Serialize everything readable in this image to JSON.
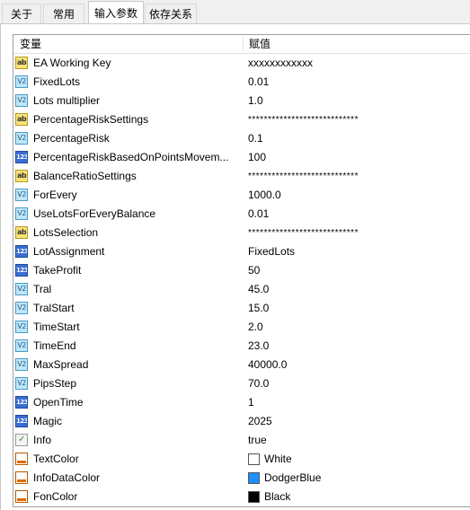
{
  "tabs": [
    {
      "label": "关于",
      "active": false
    },
    {
      "label": "常用",
      "active": false
    },
    {
      "label": "输入参数",
      "active": true
    },
    {
      "label": "依存关系",
      "active": false
    }
  ],
  "grid": {
    "headers": {
      "variable": "变量",
      "value": "赋值"
    },
    "rows": [
      {
        "icon": "string-icon",
        "glyph": "ab",
        "name": "EA Working Key",
        "value": "xxxxxxxxxxxx"
      },
      {
        "icon": "double-icon",
        "glyph": "V2",
        "name": "FixedLots",
        "value": "0.01"
      },
      {
        "icon": "double-icon",
        "glyph": "V2",
        "name": "Lots multiplier",
        "value": "1.0"
      },
      {
        "icon": "string-icon",
        "glyph": "ab",
        "name": "PercentageRiskSettings",
        "value": "****************************"
      },
      {
        "icon": "double-icon",
        "glyph": "V2",
        "name": "PercentageRisk",
        "value": "0.1"
      },
      {
        "icon": "integer-icon",
        "glyph": "123",
        "name": "PercentageRiskBasedOnPointsMovem...",
        "value": "100"
      },
      {
        "icon": "string-icon",
        "glyph": "ab",
        "name": "BalanceRatioSettings",
        "value": "****************************"
      },
      {
        "icon": "double-icon",
        "glyph": "V2",
        "name": "ForEvery",
        "value": "1000.0"
      },
      {
        "icon": "double-icon",
        "glyph": "V2",
        "name": "UseLotsForEveryBalance",
        "value": "0.01"
      },
      {
        "icon": "string-icon",
        "glyph": "ab",
        "name": "LotsSelection",
        "value": "****************************"
      },
      {
        "icon": "integer-icon",
        "glyph": "123",
        "name": "LotAssignment",
        "value": "FixedLots"
      },
      {
        "icon": "integer-icon",
        "glyph": "123",
        "name": "TakeProfit",
        "value": "50"
      },
      {
        "icon": "double-icon",
        "glyph": "V2",
        "name": "Tral",
        "value": "45.0"
      },
      {
        "icon": "double-icon",
        "glyph": "V2",
        "name": "TralStart",
        "value": "15.0"
      },
      {
        "icon": "double-icon",
        "glyph": "V2",
        "name": "TimeStart",
        "value": "2.0"
      },
      {
        "icon": "double-icon",
        "glyph": "V2",
        "name": "TimeEnd",
        "value": "23.0"
      },
      {
        "icon": "double-icon",
        "glyph": "V2",
        "name": "MaxSpread",
        "value": "40000.0"
      },
      {
        "icon": "double-icon",
        "glyph": "V2",
        "name": "PipsStep",
        "value": "70.0"
      },
      {
        "icon": "integer-icon",
        "glyph": "123",
        "name": "OpenTime",
        "value": "1"
      },
      {
        "icon": "integer-icon",
        "glyph": "123",
        "name": "Magic",
        "value": "2025"
      },
      {
        "icon": "bool-icon",
        "glyph": "✓",
        "name": "Info",
        "value": "true"
      },
      {
        "icon": "color-icon",
        "glyph": "",
        "name": "TextColor",
        "value": "White",
        "swatch": "#FFFFFF"
      },
      {
        "icon": "color-icon",
        "glyph": "",
        "name": "InfoDataColor",
        "value": "DodgerBlue",
        "swatch": "#1E90FF"
      },
      {
        "icon": "color-icon",
        "glyph": "",
        "name": "FonColor",
        "value": "Black",
        "swatch": "#000000"
      }
    ]
  }
}
